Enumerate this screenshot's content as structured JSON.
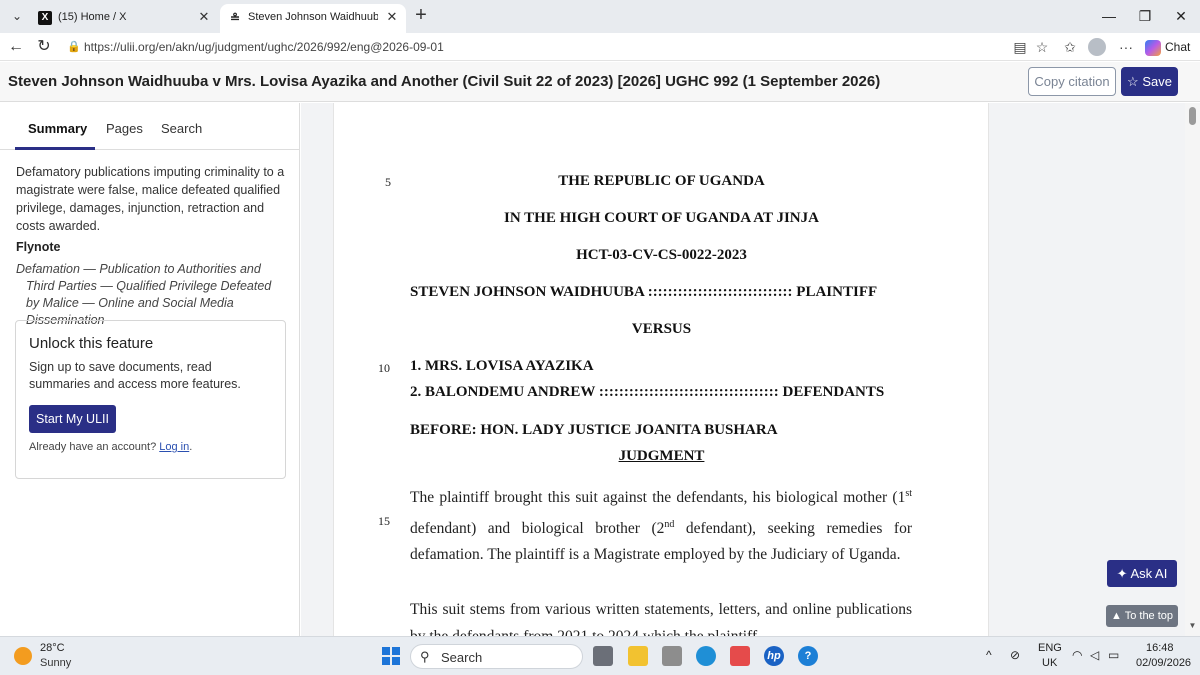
{
  "browser": {
    "tabs": [
      {
        "favicon": "X",
        "title": "(15) Home / X"
      },
      {
        "favicon": "≗",
        "title": "Steven Johnson Waidhuuba v Mrs."
      }
    ],
    "url": "https://ulii.org/en/akn/ug/judgment/ughc/2026/992/eng@2026-09-01",
    "chat_label": "Chat"
  },
  "header": {
    "title": "Steven Johnson Waidhuuba v Mrs. Lovisa Ayazika and Another (Civil Suit 22 of 2023) [2026] UGHC 992 (1 September 2026)",
    "copy_citation": "Copy citation",
    "save": "Save",
    "save_icon": "☆"
  },
  "sidebar": {
    "tabs": [
      "Summary",
      "Pages",
      "Search"
    ],
    "summary": "Defamatory publications imputing criminality to a magistrate were false, malice defeated qualified privilege, damages, injunction, retraction and costs awarded.",
    "flynote_heading": "Flynote",
    "flynote": "Defamation — Publication to Authorities and Third Parties — Qualified Privilege Defeated by Malice — Online and Social Media Dissemination",
    "unlock": {
      "heading": "Unlock this feature",
      "description": "Sign up to save documents, read summaries and access more features.",
      "button": "Start My ULII",
      "already": "Already have an account?",
      "login": "Log in",
      "period": "."
    }
  },
  "document": {
    "line_numbers": [
      "5",
      "10",
      "15"
    ],
    "republic": "THE REPUBLIC OF UGANDA",
    "court": "IN THE HIGH COURT OF UGANDA AT JINJA",
    "case_no": "HCT-03-CV-CS-0022-2023",
    "plaintiff_line": "STEVEN JOHNSON WAIDHUUBA ::::::::::::::::::::::::::::: PLAINTIFF",
    "versus": "VERSUS",
    "defendant1": "1. MRS. LOVISA AYAZIKA",
    "defendant2": "2. BALONDEMU ANDREW :::::::::::::::::::::::::::::::::::: DEFENDANTS",
    "before": "BEFORE: HON. LADY JUSTICE JOANITA BUSHARA",
    "judgment": "JUDGMENT",
    "para1": {
      "a": "The plaintiff brought this suit against the defendants, his biological mother (1",
      "sup1": "st",
      "b": " defendant) and biological brother (2",
      "sup2": "nd",
      "c": " defendant), seeking remedies for defamation. The plaintiff is a Magistrate employed by the Judiciary of Uganda."
    },
    "para2": "This suit stems from various written statements, letters, and online publications by the defendants from 2021 to 2024 which the plaintiff"
  },
  "floating": {
    "ask_ai": "Ask AI",
    "ask_ai_icon": "✦",
    "to_top": "▲ To the top"
  },
  "taskbar": {
    "temperature": "28°C",
    "condition": "Sunny",
    "search": "Search",
    "lang1": "ENG",
    "lang2": "UK",
    "time": "16:48",
    "date": "02/09/2026"
  }
}
